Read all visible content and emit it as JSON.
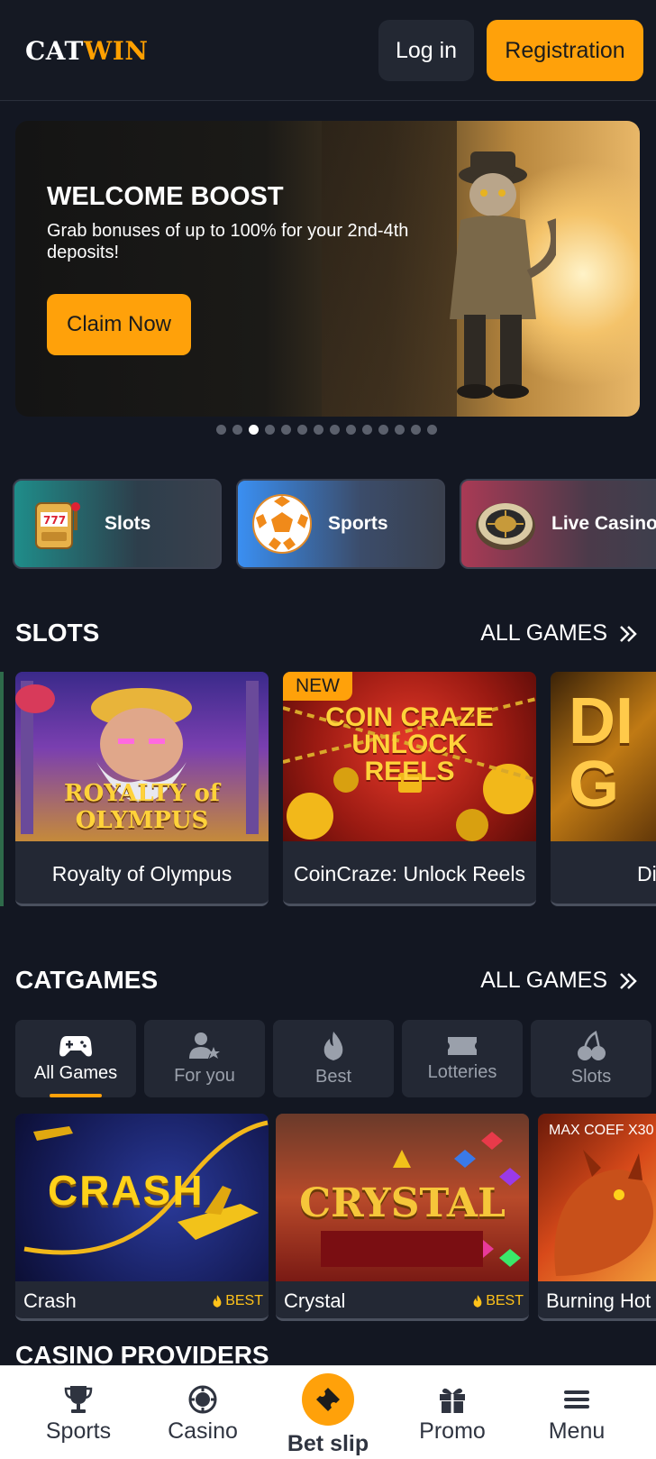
{
  "header": {
    "logo_cat": "CAT",
    "logo_win": "WIN",
    "login_label": "Log in",
    "register_label": "Registration"
  },
  "banner": {
    "title": "WELCOME BOOST",
    "subtitle": "Grab bonuses of up to 100% for your 2nd-4th deposits!",
    "cta_label": "Claim Now",
    "slide_count": 14,
    "active_slide": 3
  },
  "categories": [
    {
      "label": "Slots",
      "icon": "slot-machine-icon"
    },
    {
      "label": "Sports",
      "icon": "soccer-ball-icon"
    },
    {
      "label": "Live Casino",
      "icon": "roulette-icon"
    }
  ],
  "slots_section": {
    "title": "SLOTS",
    "all_label": "ALL GAMES",
    "cards": [
      {
        "name": "Royalty of Olympus",
        "art_text": "ROYALTY of OLYMPUS",
        "badge": ""
      },
      {
        "name": "CoinCraze: Unlock Reels",
        "art_text": "COIN CRAZE UNLOCK REELS",
        "badge": "NEW"
      },
      {
        "name": "Di",
        "art_text": "DI G",
        "badge": ""
      }
    ]
  },
  "catgames_section": {
    "title": "CATGAMES",
    "all_label": "ALL GAMES",
    "tabs": [
      {
        "label": "All Games",
        "icon": "gamepad-icon",
        "active": true
      },
      {
        "label": "For you",
        "icon": "user-star-icon",
        "active": false
      },
      {
        "label": "Best",
        "icon": "flame-icon",
        "active": false
      },
      {
        "label": "Lotteries",
        "icon": "ticket-icon",
        "active": false
      },
      {
        "label": "Slots",
        "icon": "cherries-icon",
        "active": false
      }
    ],
    "games": [
      {
        "name": "Crash",
        "art_text": "CRASH",
        "badge": "BEST",
        "coef": ""
      },
      {
        "name": "Crystal",
        "art_text": "CRYSTAL",
        "badge": "BEST",
        "coef": ""
      },
      {
        "name": "Burning Hot",
        "art_text": "",
        "badge": "",
        "coef": "MAX COEF X30"
      }
    ]
  },
  "providers_title": "CASINO PROVIDERS",
  "bottom_nav": [
    {
      "label": "Sports",
      "icon": "trophy-icon"
    },
    {
      "label": "Casino",
      "icon": "casino-chip-icon"
    },
    {
      "label": "Bet slip",
      "icon": "ticket-icon"
    },
    {
      "label": "Promo",
      "icon": "gift-icon"
    },
    {
      "label": "Menu",
      "icon": "hamburger-icon"
    }
  ],
  "colors": {
    "accent": "#ffa10a",
    "background": "#131722",
    "card": "#232834",
    "best": "#ffc21a"
  }
}
